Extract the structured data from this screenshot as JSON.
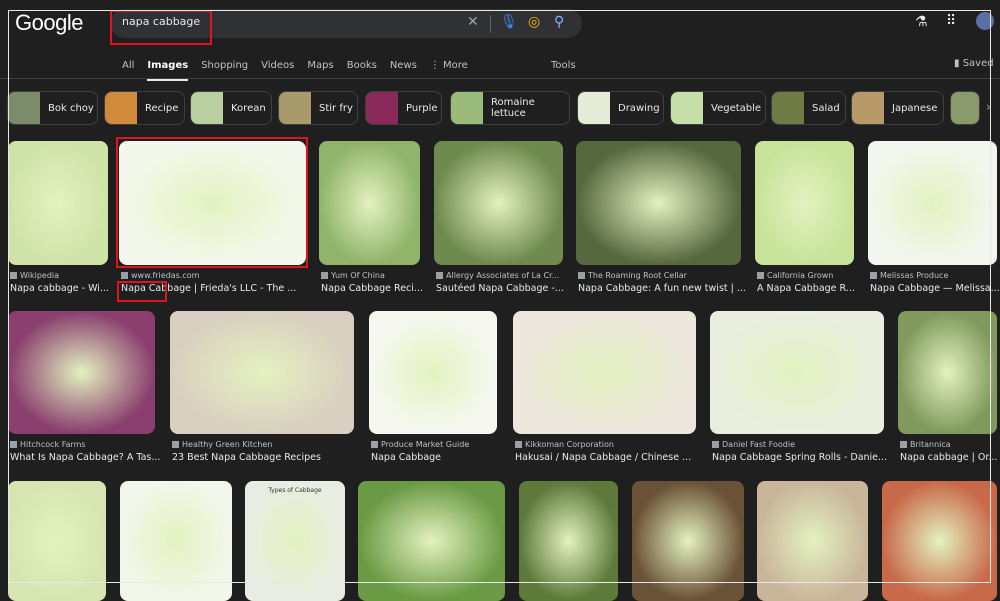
{
  "header": {
    "logo": "Google",
    "query": "napa cabbage",
    "tools": "Tools",
    "saved": "Saved"
  },
  "tabs": [
    "All",
    "Images",
    "Shopping",
    "Videos",
    "Maps",
    "Books",
    "News",
    "⋮ More"
  ],
  "active_tab": "Images",
  "chips": [
    "Bok choy",
    "Recipe",
    "Korean",
    "Stir fry",
    "Purple",
    "Romaine lettuce",
    "Drawing",
    "Vegetable",
    "Salad",
    "Japanese"
  ],
  "results": {
    "row1": [
      {
        "source": "Wikipedia",
        "title": "Napa cabbage - Wi..."
      },
      {
        "source": "www.friedas.com",
        "title": "Napa Cabbage | Frieda's LLC - The ..."
      },
      {
        "source": "Yum Of China",
        "title": "Napa Cabbage Reci..."
      },
      {
        "source": "Allergy Associates of La Cr...",
        "title": "Sautéed Napa Cabbage -..."
      },
      {
        "source": "The Roaming Root Cellar",
        "title": "Napa Cabbage: A fun new twist | ..."
      },
      {
        "source": "California Grown",
        "title": "A Napa Cabbage R..."
      },
      {
        "source": "Melissas Produce",
        "title": "Napa Cabbage — Melissa..."
      }
    ],
    "row2": [
      {
        "source": "Hitchcock Farms",
        "title": "What Is Napa Cabbage? A Tas..."
      },
      {
        "source": "Healthy Green Kitchen",
        "title": "23 Best Napa Cabbage Recipes"
      },
      {
        "source": "Produce Market Guide",
        "title": "Napa Cabbage"
      },
      {
        "source": "Kikkoman Corporation",
        "title": "Hakusai / Napa Cabbage / Chinese ..."
      },
      {
        "source": "Daniel Fast Foodie",
        "title": "Napa Cabbage Spring Rolls - Danie..."
      },
      {
        "source": "Britannica",
        "title": "Napa cabbage | Or..."
      }
    ],
    "row3_thumbnail_text": "Types of Cabbage"
  },
  "colors": {
    "background": "#1f1f1f",
    "annotation": "#e0141e"
  }
}
